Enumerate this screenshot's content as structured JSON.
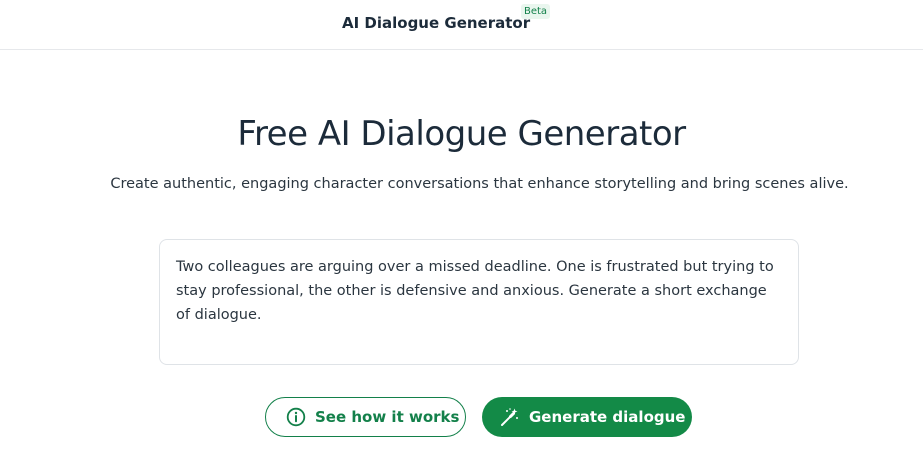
{
  "header": {
    "brand": "AI Dialogue Generator",
    "badge": "Beta"
  },
  "hero": {
    "title": "Free AI Dialogue Generator",
    "subtitle": "Create authentic, engaging character conversations that enhance storytelling and bring scenes alive."
  },
  "prompt": {
    "value": "Two colleagues are arguing over a missed deadline. One is frustrated but trying to stay professional, the other is defensive and anxious. Generate a short exchange of dialogue."
  },
  "actions": {
    "how_it_works": {
      "label": "See how it works",
      "icon": "info-circle-icon"
    },
    "generate": {
      "label": "Generate dialogue",
      "icon": "magic-wand-icon"
    }
  },
  "colors": {
    "accent": "#138a47",
    "text": "#1c2b3a",
    "border": "#dfe3e7"
  }
}
